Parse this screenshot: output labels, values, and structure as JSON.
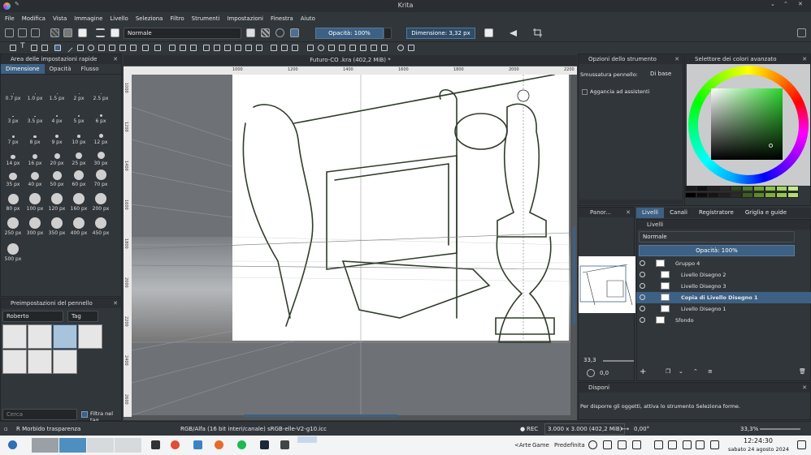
{
  "window": {
    "title": "Krita"
  },
  "menu": [
    "File",
    "Modifica",
    "Vista",
    "Immagine",
    "Livello",
    "Seleziona",
    "Filtro",
    "Strumenti",
    "Impostazioni",
    "Finestra",
    "Aiuto"
  ],
  "toolbar": {
    "blend_mode": "Normale",
    "opacity": "Opacità: 100%",
    "size": "Dimensione: 3,32 px"
  },
  "brush_panel": {
    "title": "Area delle impostazioni rapide",
    "tabs": [
      "Dimensione",
      "Opacità",
      "Flusso"
    ],
    "sizes": [
      "0.7 px",
      "1.0 px",
      "1.5 px",
      "2 px",
      "2.5 px",
      "3 px",
      "3.5 px",
      "4 px",
      "5 px",
      "6 px",
      "7 px",
      "8 px",
      "9 px",
      "10 px",
      "12 px",
      "14 px",
      "16 px",
      "20 px",
      "25 px",
      "30 px",
      "35 px",
      "40 px",
      "50 px",
      "60 px",
      "70 px",
      "80 px",
      "100 px",
      "120 px",
      "160 px",
      "200 px",
      "250 px",
      "300 px",
      "350 px",
      "400 px",
      "450 px",
      "500 px"
    ]
  },
  "presets_panel": {
    "title": "Preimpostazioni del pennello",
    "preset": "Roberto",
    "tag": "Tag",
    "search_placeholder": "Cerca",
    "filter_label": "Filtra nel tag"
  },
  "canvas": {
    "tab": "Futuro-CO .kra (402,2 MiB) *",
    "ruler_top": [
      "1000",
      "1200",
      "1400",
      "1600",
      "1800",
      "2000",
      "2200",
      "2400"
    ],
    "ruler_left": [
      "1000",
      "1200",
      "1400",
      "1600",
      "1800",
      "2000",
      "2200",
      "2400",
      "2600"
    ]
  },
  "tool_options": {
    "title": "Opzioni dello strumento",
    "smoothing_label": "Smussatura pennello:",
    "smoothing_value": "Di base",
    "snap_label": "Aggancia ad assistenti"
  },
  "color_selector": {
    "title": "Selettore dei colori avanzato"
  },
  "overview": {
    "title": "Panor...",
    "zoom": "33,3",
    "rotation": "0,0"
  },
  "layers_tabs": [
    "Livelli",
    "Canali",
    "Registratore",
    "Griglia e guide"
  ],
  "layers_panel": {
    "title": "Livelli",
    "blend": "Normale",
    "opacity": "Opacità: 100%",
    "rows": [
      {
        "name": "Gruppo 4"
      },
      {
        "name": "Livello Disegno 2"
      },
      {
        "name": "Livello Disegno 3"
      },
      {
        "name": "Copia di Livello Disegno 1"
      },
      {
        "name": "Livello Disegno 1"
      },
      {
        "name": "Sfondo"
      }
    ]
  },
  "arrange_panel": {
    "title": "Disponi",
    "message": "Per disporre gli oggetti, attiva lo strumento Seleziona forme."
  },
  "status": {
    "brush": "R Morbido trasparenza",
    "colorspace": "RGB/Alfa (16 bit interi/canale)  sRGB-elle-V2-g10.icc",
    "rec": "REC",
    "dims": "3.000 x 3.000 (402,2 MiB)",
    "angle": "0,00°",
    "zoom": "33,3%"
  },
  "taskbar": {
    "tray_text": [
      "<Arte",
      "Game",
      "Predefinita"
    ],
    "time": "12:24:30",
    "date": "sabato 24 agosto 2024"
  }
}
